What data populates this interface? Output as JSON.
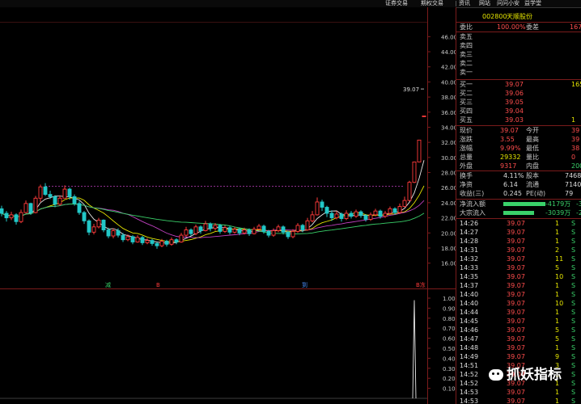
{
  "topbar": {
    "menus": [
      "证券交易",
      "期权交易",
      "|",
      "资讯",
      "网站",
      "问问小安",
      "益学堂"
    ]
  },
  "stock": {
    "code": "002800",
    "name": "天顺股份"
  },
  "price_axis": [
    "46.00",
    "44.00",
    "42.00",
    "40.00",
    "38.00",
    "36.00",
    "34.00",
    "32.00",
    "30.00",
    "28.00",
    "26.00",
    "24.00",
    "22.00",
    "20.00",
    "18.00",
    "16.00"
  ],
  "vol_axis": [
    "1.00",
    "0.90",
    "0.80",
    "0.70",
    "0.60",
    "0.50",
    "0.40",
    "0.30",
    "0.20",
    "0.10"
  ],
  "annotations": {
    "high_label": "39.07",
    "markers": [
      "减",
      "B",
      "到",
      "B冻"
    ]
  },
  "colors": {
    "up": "#ff3b3b",
    "down": "#22c7c7",
    "ma5": "#e8e8e8",
    "ma10": "#e6e600",
    "ma20": "#c040c0",
    "ma60": "#3ad16a",
    "border": "#7a1b1b"
  },
  "chart_data": {
    "type": "candlestick",
    "ylim": [
      15,
      47
    ],
    "candles": [
      [
        23.2,
        22.6,
        23.6,
        22.2
      ],
      [
        22.6,
        22.0,
        22.9,
        21.5
      ],
      [
        22.0,
        22.4,
        22.8,
        21.7
      ],
      [
        22.4,
        21.5,
        22.6,
        21.1
      ],
      [
        21.5,
        22.7,
        23.1,
        21.3
      ],
      [
        22.7,
        23.9,
        24.3,
        22.6
      ],
      [
        23.9,
        22.7,
        24.0,
        22.4
      ],
      [
        22.7,
        24.6,
        24.9,
        22.6
      ],
      [
        24.6,
        26.1,
        26.4,
        24.1
      ],
      [
        26.1,
        25.1,
        26.6,
        24.9
      ],
      [
        25.1,
        24.8,
        25.6,
        24.5
      ],
      [
        24.8,
        23.8,
        25.0,
        23.4
      ],
      [
        23.8,
        24.6,
        25.0,
        23.6
      ],
      [
        24.6,
        25.8,
        26.3,
        24.6
      ],
      [
        25.8,
        24.8,
        26.0,
        24.4
      ],
      [
        24.8,
        23.9,
        25.1,
        23.6
      ],
      [
        23.9,
        22.7,
        24.2,
        22.4
      ],
      [
        22.7,
        21.6,
        22.9,
        21.2
      ],
      [
        21.6,
        20.1,
        21.8,
        19.7
      ],
      [
        20.1,
        20.8,
        21.2,
        19.8
      ],
      [
        20.8,
        21.7,
        22.0,
        20.6
      ],
      [
        21.7,
        20.4,
        21.8,
        20.1
      ],
      [
        20.4,
        19.6,
        20.7,
        19.3
      ],
      [
        19.6,
        20.3,
        20.6,
        19.3
      ],
      [
        20.3,
        19.7,
        20.6,
        19.4
      ],
      [
        19.7,
        19.1,
        20.0,
        18.8
      ],
      [
        19.1,
        19.5,
        19.8,
        18.9
      ],
      [
        19.5,
        18.8,
        19.7,
        18.5
      ],
      [
        18.8,
        19.4,
        19.7,
        18.7
      ],
      [
        19.4,
        18.7,
        19.6,
        18.4
      ],
      [
        18.7,
        19.0,
        19.3,
        18.5
      ],
      [
        19.0,
        18.6,
        19.2,
        18.3
      ],
      [
        18.6,
        18.3,
        18.8,
        17.9
      ],
      [
        18.3,
        18.9,
        19.2,
        18.1
      ],
      [
        18.9,
        18.5,
        19.1,
        18.2
      ],
      [
        18.5,
        19.1,
        19.4,
        18.3
      ],
      [
        19.1,
        18.8,
        19.3,
        18.5
      ],
      [
        18.8,
        19.7,
        20.0,
        18.7
      ],
      [
        19.7,
        20.4,
        20.8,
        19.5
      ],
      [
        20.4,
        19.9,
        20.6,
        19.6
      ],
      [
        19.9,
        20.8,
        21.1,
        19.7
      ],
      [
        20.8,
        20.3,
        21.0,
        19.9
      ],
      [
        20.3,
        21.2,
        21.6,
        20.2
      ],
      [
        21.2,
        20.6,
        21.4,
        20.2
      ],
      [
        20.6,
        21.0,
        21.3,
        20.3
      ],
      [
        21.0,
        20.2,
        21.2,
        19.9
      ],
      [
        20.2,
        20.7,
        21.0,
        20.0
      ],
      [
        20.7,
        20.1,
        20.9,
        19.8
      ],
      [
        20.1,
        20.5,
        20.8,
        19.9
      ],
      [
        20.5,
        20.0,
        20.7,
        19.7
      ],
      [
        20.0,
        20.4,
        20.7,
        19.8
      ],
      [
        20.4,
        19.9,
        20.6,
        19.6
      ],
      [
        19.9,
        20.5,
        20.8,
        19.8
      ],
      [
        20.5,
        20.9,
        21.2,
        20.3
      ],
      [
        20.9,
        20.2,
        21.1,
        19.9
      ],
      [
        20.2,
        19.7,
        20.4,
        19.4
      ],
      [
        19.7,
        20.3,
        20.6,
        19.5
      ],
      [
        20.3,
        20.8,
        21.1,
        20.1
      ],
      [
        20.8,
        20.1,
        21.0,
        19.8
      ],
      [
        20.1,
        19.5,
        20.3,
        19.2
      ],
      [
        19.5,
        20.2,
        20.5,
        19.3
      ],
      [
        20.2,
        21.0,
        21.3,
        20.0
      ],
      [
        21.0,
        20.4,
        21.2,
        20.1
      ],
      [
        20.4,
        21.6,
        22.0,
        20.3
      ],
      [
        21.6,
        22.4,
        22.9,
        21.4
      ],
      [
        22.4,
        24.1,
        24.7,
        22.3
      ],
      [
        24.1,
        23.4,
        24.4,
        22.9
      ],
      [
        23.4,
        22.6,
        23.6,
        22.1
      ],
      [
        22.6,
        22.0,
        23.0,
        21.6
      ],
      [
        22.0,
        22.5,
        22.9,
        21.8
      ],
      [
        22.5,
        21.9,
        22.7,
        21.5
      ],
      [
        21.9,
        22.6,
        23.0,
        21.7
      ],
      [
        22.6,
        22.2,
        22.9,
        21.9
      ],
      [
        22.2,
        22.8,
        23.1,
        22.0
      ],
      [
        22.8,
        22.3,
        23.0,
        22.0
      ],
      [
        22.3,
        21.8,
        22.5,
        21.5
      ],
      [
        21.8,
        22.4,
        22.7,
        21.6
      ],
      [
        22.4,
        22.9,
        23.2,
        22.2
      ],
      [
        22.9,
        22.2,
        23.1,
        21.9
      ],
      [
        22.2,
        22.6,
        22.9,
        22.0
      ],
      [
        22.6,
        23.2,
        23.5,
        22.4
      ],
      [
        23.2,
        22.7,
        23.4,
        22.4
      ],
      [
        22.7,
        23.5,
        23.9,
        22.5
      ],
      [
        23.5,
        24.3,
        24.8,
        23.4
      ],
      [
        24.3,
        26.7,
        26.9,
        24.2
      ],
      [
        26.7,
        29.4,
        29.4,
        26.6
      ],
      [
        29.4,
        32.3,
        32.3,
        29.4
      ],
      [
        35.5,
        35.5,
        35.5,
        35.5
      ]
    ],
    "dashed_high": 26.2,
    "volume": {
      "spike_value": 0.98,
      "baseline": 0.0
    }
  },
  "panel": {
    "weibi": {
      "label": "委比",
      "pct": "100.00%",
      "diff_label": "委差",
      "diff": "167"
    },
    "sells": [
      {
        "label": "卖五",
        "price": "",
        "vol": ""
      },
      {
        "label": "卖四",
        "price": "",
        "vol": ""
      },
      {
        "label": "卖三",
        "price": "",
        "vol": ""
      },
      {
        "label": "卖二",
        "price": "",
        "vol": ""
      },
      {
        "label": "卖一",
        "price": "",
        "vol": ""
      }
    ],
    "buys": [
      {
        "label": "买一",
        "price": "39.07",
        "vol": "165"
      },
      {
        "label": "买二",
        "price": "39.06",
        "vol": ""
      },
      {
        "label": "买三",
        "price": "39.05",
        "vol": ""
      },
      {
        "label": "买四",
        "price": "39.04",
        "vol": ""
      },
      {
        "label": "买五",
        "price": "39.03",
        "vol": "1"
      }
    ],
    "quote": [
      {
        "l1": "现价",
        "v1": "39.07",
        "l2": "今开",
        "v2": "39"
      },
      {
        "l1": "涨跌",
        "v1": "3.55",
        "l2": "最高",
        "v2": "39"
      },
      {
        "l1": "涨幅",
        "v1": "9.99%",
        "l2": "最低",
        "v2": "38"
      },
      {
        "l1": "总量",
        "v1": "29332",
        "l2": "量比",
        "v2": "0"
      },
      {
        "l1": "外盘",
        "v1": "9317",
        "l2": "内盘",
        "v2": "200"
      }
    ],
    "fund": [
      {
        "l1": "换手",
        "v1": "4.11%",
        "l2": "股本",
        "v2": "7468"
      },
      {
        "l1": "净资",
        "v1": "6.14",
        "l2": "流通",
        "v2": "7140"
      },
      {
        "l1": "收益(三)",
        "v1": "0.245",
        "l2": "PE(动)",
        "v2": "79"
      }
    ],
    "flows": [
      {
        "label": "净流入额",
        "value": "-4179万",
        "tail": "-3"
      },
      {
        "label": "大宗流入",
        "value": "-3039万",
        "tail": "-2"
      }
    ],
    "ticks": [
      {
        "time": "14:26",
        "price": "39.07",
        "vol": "1",
        "bs": "S"
      },
      {
        "time": "14:27",
        "price": "39.07",
        "vol": "1",
        "bs": "S"
      },
      {
        "time": "14:28",
        "price": "39.07",
        "vol": "1",
        "bs": "S"
      },
      {
        "time": "14:31",
        "price": "39.07",
        "vol": "2",
        "bs": "S"
      },
      {
        "time": "14:32",
        "price": "39.07",
        "vol": "11",
        "bs": "S"
      },
      {
        "time": "14:33",
        "price": "39.07",
        "vol": "5",
        "bs": "S"
      },
      {
        "time": "14:35",
        "price": "39.07",
        "vol": "10",
        "bs": "S"
      },
      {
        "time": "14:37",
        "price": "39.07",
        "vol": "1",
        "bs": "S"
      },
      {
        "time": "14:40",
        "price": "39.07",
        "vol": "1",
        "bs": "S"
      },
      {
        "time": "14:40",
        "price": "39.07",
        "vol": "10",
        "bs": "S"
      },
      {
        "time": "14:44",
        "price": "39.07",
        "vol": "1",
        "bs": "S"
      },
      {
        "time": "14:45",
        "price": "39.07",
        "vol": "1",
        "bs": "S"
      },
      {
        "time": "14:46",
        "price": "39.07",
        "vol": "5",
        "bs": "S"
      },
      {
        "time": "14:47",
        "price": "39.07",
        "vol": "5",
        "bs": "S"
      },
      {
        "time": "14:48",
        "price": "39.07",
        "vol": "1",
        "bs": "S"
      },
      {
        "time": "14:49",
        "price": "39.07",
        "vol": "9",
        "bs": "S"
      },
      {
        "time": "14:51",
        "price": "39.07",
        "vol": "3",
        "bs": "S"
      },
      {
        "time": "14:52",
        "price": "39.07",
        "vol": "1",
        "bs": "S"
      },
      {
        "time": "14:52",
        "price": "39.07",
        "vol": "1",
        "bs": "S"
      },
      {
        "time": "14:53",
        "price": "39.07",
        "vol": "1",
        "bs": "S"
      },
      {
        "time": "14:53",
        "price": "39.07",
        "vol": "1",
        "bs": "S"
      }
    ]
  },
  "watermark": {
    "text": "抓妖指标"
  }
}
